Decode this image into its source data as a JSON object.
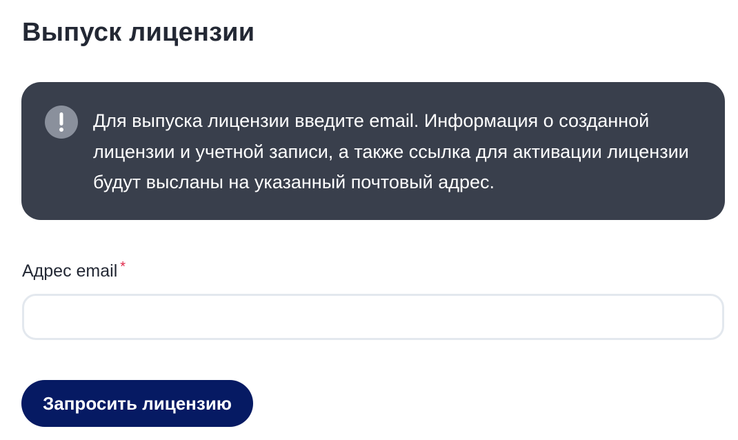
{
  "page": {
    "title": "Выпуск лицензии"
  },
  "alert": {
    "icon": "exclamation-icon",
    "text": "Для выпуска лицензии введите email. Информация о созданной лицензии и учетной записи, а также ссылка для активации лицензии будут высланы на указанный почтовый адрес."
  },
  "form": {
    "email_label": "Адрес email",
    "required_mark": "*",
    "email_value": "",
    "email_placeholder": "",
    "submit_label": "Запросить лицензию"
  },
  "colors": {
    "alert_background": "#393f4c",
    "button_background": "#061a63",
    "required_mark": "#e0284a",
    "input_border": "#e3e8ee"
  }
}
